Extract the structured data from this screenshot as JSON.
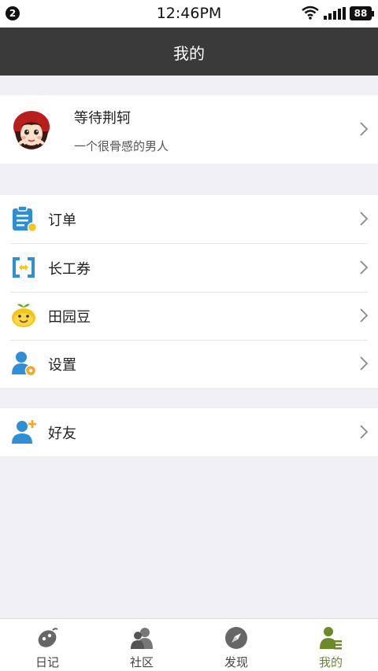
{
  "status_bar": {
    "notification_count": "2",
    "time": "12:46PM",
    "battery": "88"
  },
  "header": {
    "title": "我的"
  },
  "profile": {
    "name": "等待荆轲",
    "bio": "一个很骨感的男人"
  },
  "menu": {
    "items": [
      {
        "label": "订单",
        "icon": "clipboard-icon"
      },
      {
        "label": "长工券",
        "icon": "coupon-icon"
      },
      {
        "label": "田园豆",
        "icon": "bean-mascot-icon"
      },
      {
        "label": "设置",
        "icon": "user-gear-icon"
      }
    ],
    "friends": {
      "label": "好友",
      "icon": "add-friend-icon"
    }
  },
  "tabs": [
    {
      "label": "日记",
      "icon": "diary-icon",
      "active": false
    },
    {
      "label": "社区",
      "icon": "community-icon",
      "active": false
    },
    {
      "label": "发现",
      "icon": "compass-icon",
      "active": false
    },
    {
      "label": "我的",
      "icon": "profile-icon",
      "active": true
    }
  ],
  "colors": {
    "accent": "#6c8a2a",
    "header_bg": "#3a3a3a",
    "icon_blue": "#2f8fd6",
    "page_bg": "#efeff4"
  }
}
